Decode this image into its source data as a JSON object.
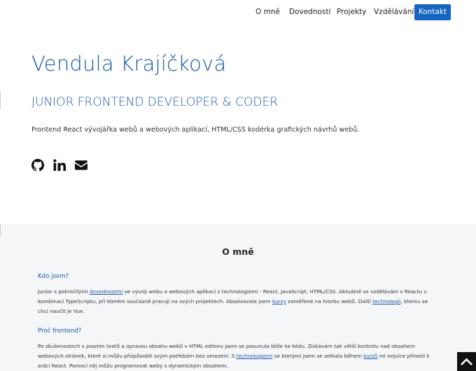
{
  "nav": {
    "items": [
      "O mně",
      "Dovednosti",
      "Projekty",
      "Vzdělávání"
    ],
    "cta": "Kontakt"
  },
  "hero": {
    "name": "Vendula Krajíčková",
    "role": "JUNIOR FRONTEND DEVELOPER & CODER",
    "description": "Frontend React vývojářka webů a webových aplikací, HTML/CSS kodérka grafických návrhů webů.",
    "socials": [
      "github-icon",
      "linkedin-icon",
      "envelope-icon"
    ]
  },
  "about": {
    "title": "O mně",
    "q1": "Kdo jsem?",
    "p1": {
      "t1": "Junior s pokročilými ",
      "l1": "dovednostmi",
      "t2": " ve vývoji webu a webových aplikací s technologiemi - React, JavaScript, HTML/CSS. Aktuálně se vzdělávám v Reactu v kombinaci TypeScriptu, při kterém současně pracuji na svých projektech. Absolvovala jsem ",
      "l2": "kurzy",
      "t3": " zaměřené na tvorbu webů. Další ",
      "l3": "technologii",
      "t4": ", kterou se chci naučit je Vue."
    },
    "q2": "Proč frontend?",
    "p2": {
      "t1": "Po zkušenostech s psaním textů a úpravou obsahu webů v HTML editoru jsem se posunula blíže ke kódu. Získávám tak větší kontrolu nad obsahem webových stránek, které si můžu přizpůsobit svým potřebám bez omezení. S ",
      "l1": "technologiemi",
      "t2": " se kterými jsem se setkala během ",
      "l2": "kurzů",
      "t3": " mi nejvíce přirostl k srdci React. Pomocí něj můžu programovat weby s dynamickým obsahem."
    }
  },
  "colors": {
    "accent": "#1a5aa6",
    "cta": "#1565c0",
    "section_bg": "#f5f6f8"
  },
  "scroll_top_icon": "chevron-up-icon"
}
